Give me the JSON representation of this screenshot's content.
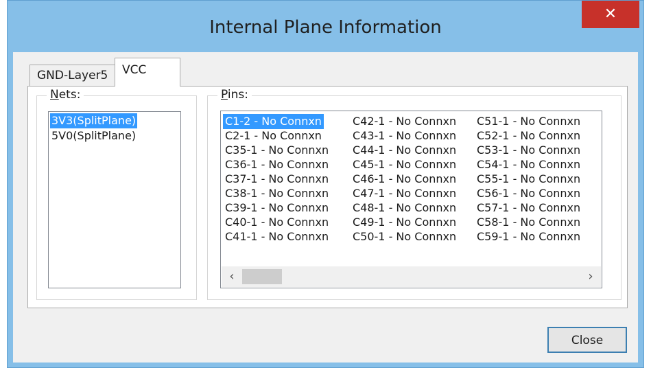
{
  "window": {
    "title": "Internal Plane Information",
    "close_glyph": "✕"
  },
  "tabs": [
    {
      "label": "GND-Layer5",
      "active": false
    },
    {
      "label": "VCC",
      "active": true
    }
  ],
  "nets": {
    "label_accel": "N",
    "label_rest": "ets:",
    "items": [
      {
        "label": "3V3(SplitPlane)",
        "selected": true
      },
      {
        "label": "5V0(SplitPlane)",
        "selected": false
      }
    ]
  },
  "pins": {
    "label_accel": "P",
    "label_rest": "ins:",
    "columns": [
      [
        "C1-2 - No Connxn",
        "C2-1 - No Connxn",
        "C35-1 - No Connxn",
        "C36-1 - No Connxn",
        "C37-1 - No Connxn",
        "C38-1 - No Connxn",
        "C39-1 - No Connxn",
        "C40-1 - No Connxn",
        "C41-1 - No Connxn"
      ],
      [
        "C42-1 - No Connxn",
        "C43-1 - No Connxn",
        "C44-1 - No Connxn",
        "C45-1 - No Connxn",
        "C46-1 - No Connxn",
        "C47-1 - No Connxn",
        "C48-1 - No Connxn",
        "C49-1 - No Connxn",
        "C50-1 - No Connxn"
      ],
      [
        "C51-1 - No Connxn",
        "C52-1 - No Connxn",
        "C53-1 - No Connxn",
        "C54-1 - No Connxn",
        "C55-1 - No Connxn",
        "C56-1 - No Connxn",
        "C57-1 - No Connxn",
        "C58-1 - No Connxn",
        "C59-1 - No Connxn"
      ]
    ],
    "selected": "C1-2 - No Connxn"
  },
  "scrollbar": {
    "left_glyph": "‹",
    "right_glyph": "›"
  },
  "buttons": {
    "close_label": "Close"
  },
  "colors": {
    "titlebar": "#86bfe8",
    "close_red": "#c7312a",
    "selection": "#3399ff",
    "button_border": "#3c7fb1"
  }
}
